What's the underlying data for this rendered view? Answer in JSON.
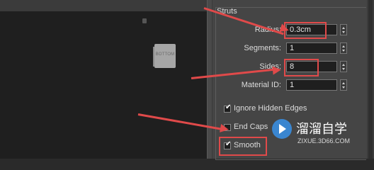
{
  "panel": {
    "group_title": "Struts",
    "radius": {
      "label": "Radius:",
      "value": "0.3cm"
    },
    "segments": {
      "label": "Segments:",
      "value": "1"
    },
    "sides": {
      "label": "Sides:",
      "value": "8"
    },
    "material_id": {
      "label": "Material ID:",
      "value": "1"
    },
    "ignore_hidden_edges": {
      "label": "Ignore Hidden Edges",
      "checked": true
    },
    "end_caps": {
      "label": "End Caps",
      "checked": false
    },
    "smooth": {
      "label": "Smooth",
      "checked": true
    }
  },
  "viewport": {
    "viewcube_label": "BOTTOM"
  },
  "watermark": {
    "title": "溜溜自学",
    "site": "ZIXUE.3D66.COM"
  },
  "colors": {
    "accent_red": "#e04a4a",
    "watermark_blue": "#3a86d0"
  }
}
